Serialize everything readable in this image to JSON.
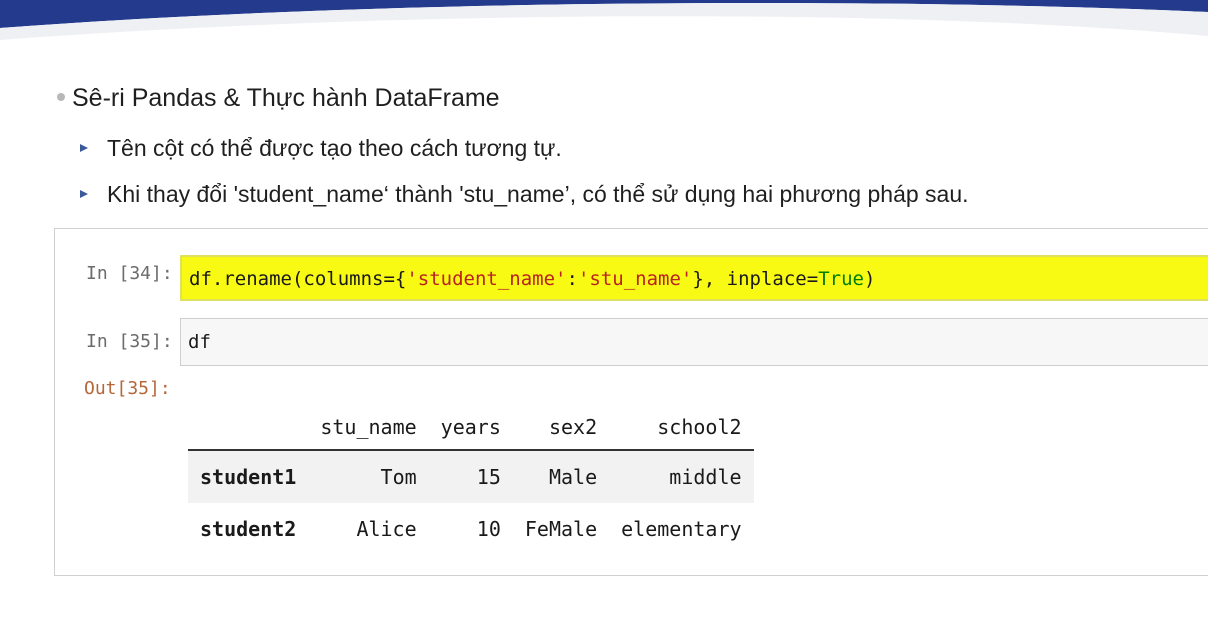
{
  "slide": {
    "title": "Sê-ri Pandas & Thực hành DataFrame",
    "bullets": [
      "Tên cột có thể được tạo theo cách tương tự.",
      "Khi thay đổi 'student_name‘ thành 'stu_name’, có thể sử dụng hai phương pháp sau."
    ]
  },
  "notebook": {
    "cell_34": {
      "prompt": "In [34]:",
      "code_prefix": "df.rename(columns={",
      "code_str1": "'student_name'",
      "code_colon": ":",
      "code_str2": "'stu_name'",
      "code_mid": "}, inplace=",
      "code_kw": "True",
      "code_suffix": ")"
    },
    "cell_35": {
      "prompt": "In [35]:",
      "code": "df"
    },
    "out_35": {
      "prompt": "Out[35]:",
      "table": {
        "index_header": "",
        "columns": [
          "stu_name",
          "years",
          "sex2",
          "school2"
        ],
        "rows": [
          {
            "index": "student1",
            "values": [
              "Tom",
              "15",
              "Male",
              "middle"
            ]
          },
          {
            "index": "student2",
            "values": [
              "Alice",
              "10",
              "FeMale",
              "elementary"
            ]
          }
        ]
      }
    }
  },
  "colors": {
    "highlight": "#f8fa14",
    "banner": "#243a8c",
    "string": "#ba2121",
    "keyword": "#008000"
  }
}
